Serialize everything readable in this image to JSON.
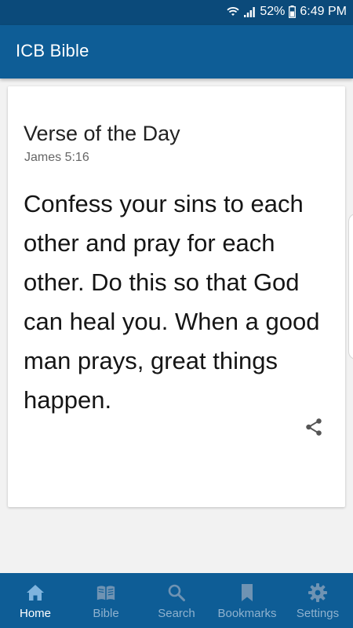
{
  "status_bar": {
    "battery": "52%",
    "time": "6:49 PM"
  },
  "app_bar": {
    "title": "ICB Bible"
  },
  "verse_card": {
    "heading": "Verse of the Day",
    "reference": "James 5:16",
    "text": "Confess your sins to each other and pray for each other. Do this so that God can heal you. When a good man prays, great things happen.",
    "share_icon": "share-icon"
  },
  "bottom_nav": {
    "items": [
      {
        "label": "Home",
        "icon": "home-icon",
        "active": true
      },
      {
        "label": "Bible",
        "icon": "book-icon",
        "active": false
      },
      {
        "label": "Search",
        "icon": "search-icon",
        "active": false
      },
      {
        "label": "Bookmarks",
        "icon": "bookmark-icon",
        "active": false
      },
      {
        "label": "Settings",
        "icon": "gear-icon",
        "active": false
      }
    ]
  },
  "colors": {
    "primary": "#0e5d96",
    "status_bar": "#0b4a7a",
    "nav_inactive": "#8fb2cf",
    "nav_active": "#ffffff"
  }
}
